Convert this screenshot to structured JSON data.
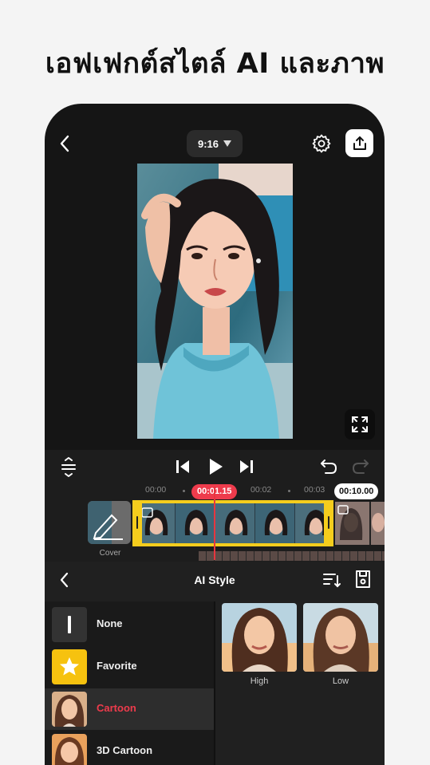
{
  "headline": "เอฟเฟกต์สไตล์ AI และภาพ",
  "editor": {
    "aspect_ratio": "9:16",
    "icons": {
      "back": "chevron-left-icon",
      "settings": "gear-icon",
      "export": "upload-icon",
      "fullscreen": "expand-icon"
    }
  },
  "timeline": {
    "ruler": [
      "00:00",
      "00:02",
      "00:03"
    ],
    "current_time": "00:01.15",
    "total_time": "00:10.00",
    "cover_label": "Cover"
  },
  "ai_panel": {
    "title": "AI Style",
    "styles": [
      {
        "label": "None"
      },
      {
        "label": "Favorite"
      },
      {
        "label": "Cartoon"
      },
      {
        "label": "3D Cartoon"
      }
    ],
    "variants": [
      {
        "label": "High"
      },
      {
        "label": "Low"
      }
    ]
  },
  "colors": {
    "accent_red": "#ee3b4c",
    "trim_yellow": "#f5cd1d",
    "favorite_yellow": "#f6c20f"
  }
}
